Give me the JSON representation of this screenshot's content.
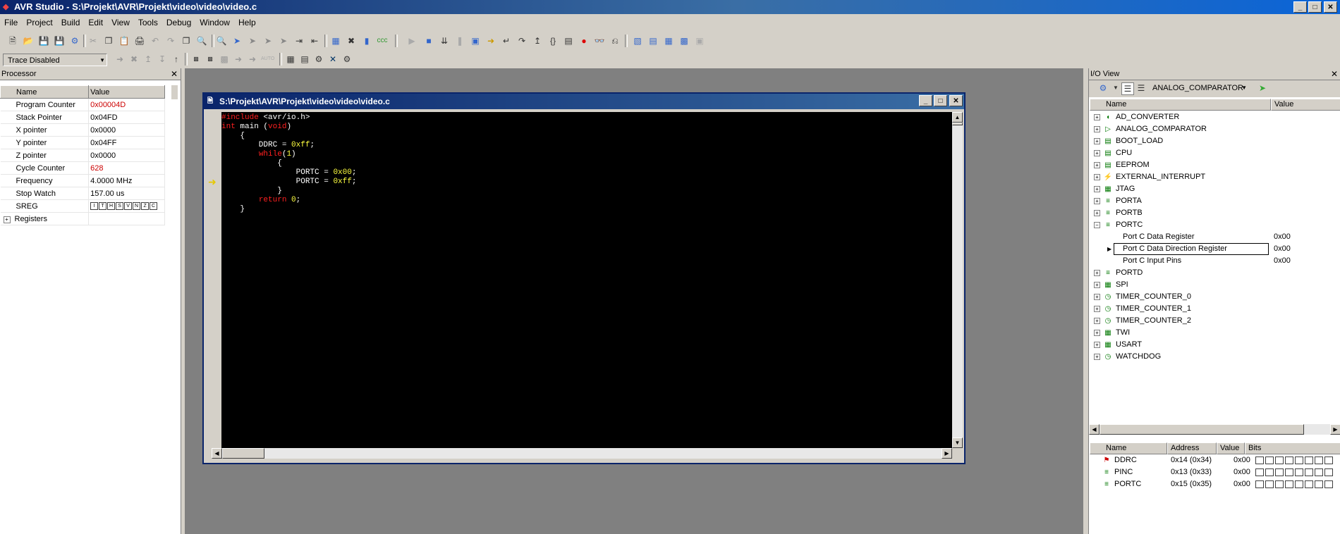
{
  "app": {
    "title": "AVR Studio - S:\\Projekt\\AVR\\Projekt\\video\\video\\video.c"
  },
  "menu": [
    "File",
    "Project",
    "Build",
    "Edit",
    "View",
    "Tools",
    "Debug",
    "Window",
    "Help"
  ],
  "trace": {
    "value": "Trace Disabled"
  },
  "processor": {
    "title": "Processor",
    "headers": {
      "name": "Name",
      "value": "Value"
    },
    "rows": [
      {
        "name": "Program Counter",
        "value": "0x00004D",
        "highlight": true
      },
      {
        "name": "Stack Pointer",
        "value": "0x04FD"
      },
      {
        "name": "X pointer",
        "value": "0x0000"
      },
      {
        "name": "Y pointer",
        "value": "0x04FF"
      },
      {
        "name": "Z pointer",
        "value": "0x0000"
      },
      {
        "name": "Cycle Counter",
        "value": "628",
        "highlight": true
      },
      {
        "name": "Frequency",
        "value": "4.0000 MHz"
      },
      {
        "name": "Stop Watch",
        "value": "157.00 us"
      },
      {
        "name": "SREG",
        "value": ""
      },
      {
        "name": "Registers",
        "value": ""
      }
    ],
    "sreg_flags": [
      "I",
      "T",
      "H",
      "S",
      "V",
      "N",
      "Z",
      "C"
    ]
  },
  "editor": {
    "title": "S:\\Projekt\\AVR\\Projekt\\video\\video\\video.c",
    "lines": [
      {
        "parts": [
          [
            "kw",
            "#include "
          ],
          [
            "txt",
            "<avr/io.h>"
          ]
        ]
      },
      {
        "parts": [
          [
            "kw",
            "int"
          ],
          [
            "txt",
            " main ("
          ],
          [
            "kw",
            "void"
          ],
          [
            "txt",
            ")"
          ]
        ]
      },
      {
        "parts": [
          [
            "txt",
            "    {"
          ]
        ]
      },
      {
        "parts": [
          [
            "txt",
            "        DDRC = "
          ],
          [
            "num",
            "0xff"
          ],
          [
            "txt",
            ";"
          ]
        ]
      },
      {
        "parts": [
          [
            "txt",
            "        "
          ],
          [
            "kw",
            "while"
          ],
          [
            "txt",
            "("
          ],
          [
            "num",
            "1"
          ],
          [
            "txt",
            ")"
          ]
        ]
      },
      {
        "parts": [
          [
            "txt",
            "            {"
          ]
        ]
      },
      {
        "parts": [
          [
            "txt",
            "                PORTC = "
          ],
          [
            "num",
            "0x00"
          ],
          [
            "txt",
            ";"
          ]
        ]
      },
      {
        "parts": [
          [
            "txt",
            "                PORTC = "
          ],
          [
            "num",
            "0xff"
          ],
          [
            "txt",
            ";"
          ]
        ]
      },
      {
        "parts": [
          [
            "txt",
            "            }"
          ]
        ]
      },
      {
        "parts": [
          [
            "txt",
            "        "
          ],
          [
            "kw",
            "return"
          ],
          [
            "txt",
            " "
          ],
          [
            "num",
            "0"
          ],
          [
            "txt",
            ";"
          ]
        ]
      },
      {
        "parts": [
          [
            "txt",
            "    }"
          ]
        ]
      }
    ],
    "colors": {
      "kw": "#ff2020",
      "num": "#ffff40",
      "txt": "#ffffff"
    }
  },
  "io_view": {
    "title": "I/O View",
    "combo": "ANALOG_COMPARATOR",
    "headers": {
      "name": "Name",
      "value": "Value"
    },
    "tree": [
      {
        "label": "AD_CONVERTER",
        "icon": "adc-icon",
        "expander": "+"
      },
      {
        "label": "ANALOG_COMPARATOR",
        "icon": "comparator-icon",
        "expander": "+"
      },
      {
        "label": "BOOT_LOAD",
        "icon": "memory-icon",
        "expander": "+"
      },
      {
        "label": "CPU",
        "icon": "memory-icon",
        "expander": "+"
      },
      {
        "label": "EEPROM",
        "icon": "memory-icon",
        "expander": "+"
      },
      {
        "label": "EXTERNAL_INTERRUPT",
        "icon": "interrupt-icon",
        "expander": "+"
      },
      {
        "label": "JTAG",
        "icon": "jtag-icon",
        "expander": "+"
      },
      {
        "label": "PORTA",
        "icon": "port-icon",
        "expander": "+"
      },
      {
        "label": "PORTB",
        "icon": "port-icon",
        "expander": "+"
      },
      {
        "label": "PORTC",
        "icon": "port-icon",
        "expander": "-"
      },
      {
        "label": "Port C Data Register",
        "value": "0x00",
        "child": true
      },
      {
        "label": "Port C Data Direction Register",
        "value": "0x00",
        "child": true,
        "selected": true
      },
      {
        "label": "Port C Input Pins",
        "value": "0x00",
        "child": true
      },
      {
        "label": "PORTD",
        "icon": "port-icon",
        "expander": "+"
      },
      {
        "label": "SPI",
        "icon": "spi-icon",
        "expander": "+"
      },
      {
        "label": "TIMER_COUNTER_0",
        "icon": "timer-icon",
        "expander": "+"
      },
      {
        "label": "TIMER_COUNTER_1",
        "icon": "timer-icon",
        "expander": "+"
      },
      {
        "label": "TIMER_COUNTER_2",
        "icon": "timer-icon",
        "expander": "+"
      },
      {
        "label": "TWI",
        "icon": "twi-icon",
        "expander": "+"
      },
      {
        "label": "USART",
        "icon": "usart-icon",
        "expander": "+"
      },
      {
        "label": "WATCHDOG",
        "icon": "watchdog-icon",
        "expander": "+"
      }
    ],
    "reg_headers": {
      "name": "Name",
      "address": "Address",
      "value": "Value",
      "bits": "Bits"
    },
    "registers": [
      {
        "name": "DDRC",
        "address": "0x14 (0x34)",
        "value": "0x00"
      },
      {
        "name": "PINC",
        "address": "0x13 (0x33)",
        "value": "0x00"
      },
      {
        "name": "PORTC",
        "address": "0x15 (0x35)",
        "value": "0x00"
      }
    ]
  }
}
